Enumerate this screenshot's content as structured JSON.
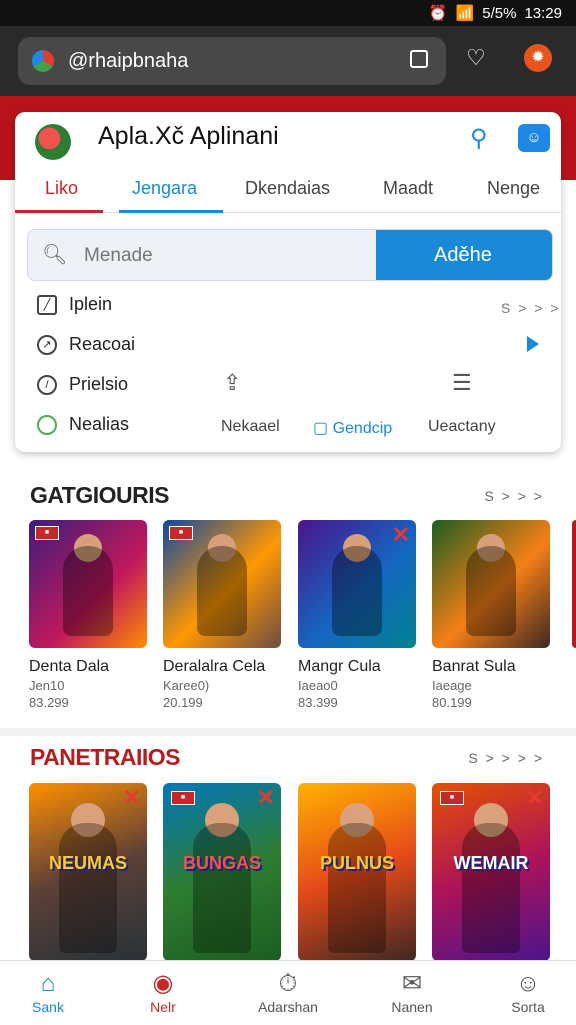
{
  "status_bar": {
    "icons": [
      "alarm-icon",
      "wifi-icon",
      "signal-icon"
    ],
    "battery": "5/5%",
    "time": "13:29"
  },
  "browser": {
    "url": "@rhaipbnaha",
    "tab_icon": "tab-switcher-icon",
    "shield_icon": "shield-heart-icon",
    "extension_icon": "extension-icon"
  },
  "app": {
    "title": "Apla.Xč Aplinani",
    "logo": "app-logo",
    "search_icon": "search-icon",
    "chat_icon": "chat-icon"
  },
  "tabs": [
    {
      "label": "Liko"
    },
    {
      "label": "Jengara"
    },
    {
      "label": "Dkendaias"
    },
    {
      "label": "Maadt"
    },
    {
      "label": "Nenge"
    }
  ],
  "search": {
    "placeholder": "Menade",
    "button_label": "Aděhe"
  },
  "options": [
    {
      "label": "Iplein",
      "icon": "edit-square-icon"
    },
    {
      "label": "Reacoai",
      "icon": "clock-icon"
    },
    {
      "label": "Prielsio",
      "icon": "compass-icon"
    },
    {
      "label": "Nealias",
      "icon": "circle-icon"
    }
  ],
  "options_more": "S > > >",
  "quick_actions": [
    {
      "label": "Nekaael",
      "icon": "share-icon"
    },
    {
      "label": "Gendcip",
      "icon": "chat-bubble-icon"
    },
    {
      "label": "Ueactany",
      "icon": "list-icon"
    }
  ],
  "section1": {
    "title": "GATGIOURIS",
    "more": "S > > >",
    "games": [
      {
        "name": "Denta Dala",
        "sub": "Jen10",
        "count": "83.299"
      },
      {
        "name": "Deralalra Cela",
        "sub": "Karee0)",
        "count": "20.199"
      },
      {
        "name": "Mangr Cula",
        "sub": "Iaeao0",
        "count": "83.399"
      },
      {
        "name": "Banrat Sula",
        "sub": "Iaeage",
        "count": "80.199"
      }
    ]
  },
  "section2": {
    "title": "PANETRAIIOS",
    "more": "S > > > >",
    "games": [
      {
        "logo": "NEUMAS"
      },
      {
        "logo": "BUNGAS"
      },
      {
        "logo": "PULNUS"
      },
      {
        "logo": "WEMAIR"
      }
    ]
  },
  "bottom_nav": [
    {
      "label": "Sank",
      "icon": "home-icon"
    },
    {
      "label": "Nelr",
      "icon": "gamepad-icon"
    },
    {
      "label": "Adarshan",
      "icon": "timer-icon"
    },
    {
      "label": "Nanen",
      "icon": "message-icon"
    },
    {
      "label": "Sorta",
      "icon": "person-icon"
    }
  ],
  "colors": {
    "brand_red": "#b9131a",
    "accent_blue": "#1a8ad8"
  }
}
